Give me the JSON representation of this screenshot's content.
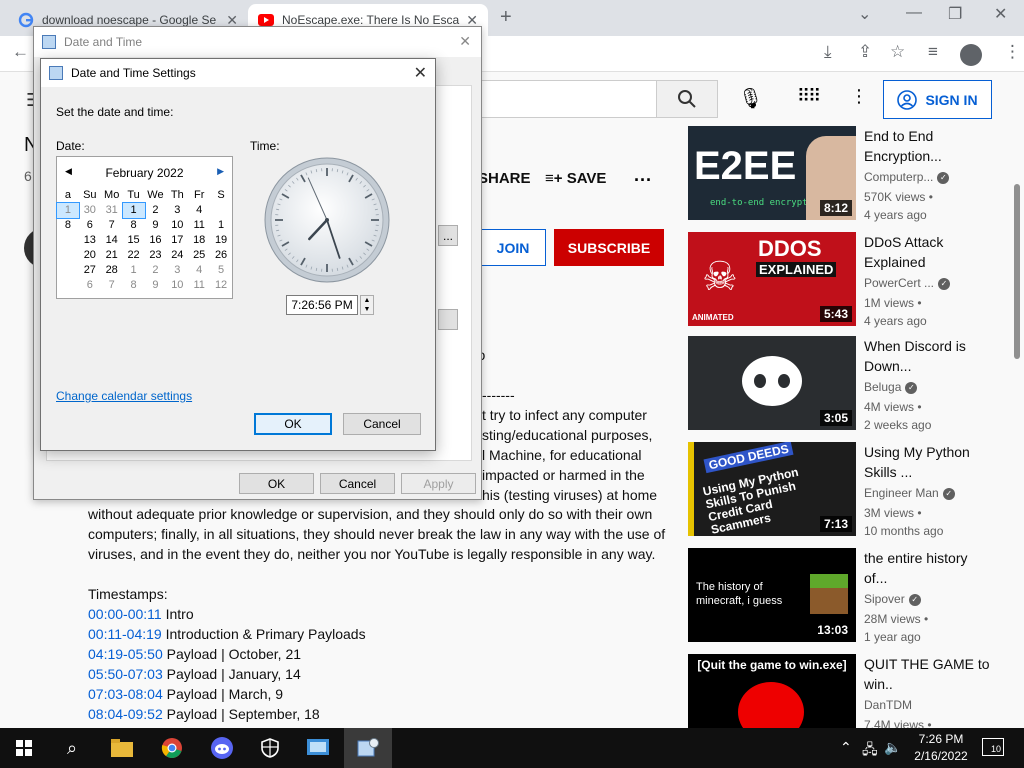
{
  "browser": {
    "tabs": [
      {
        "title": "download noescape - Google Se",
        "close": "✕"
      },
      {
        "title": "NoEscape.exe: There Is No Escap",
        "close": "✕"
      }
    ],
    "new_tab": "+",
    "win_controls": [
      "⌄",
      "—",
      "❐",
      "✕"
    ]
  },
  "youtube": {
    "sign_in": "SIGN IN",
    "title_partial": "N",
    "views_partial": "6",
    "share": "SHARE",
    "save": "SAVE",
    "join": "JOIN",
    "subscribe": "SUBSCRIBE",
    "desc_fragments": [
      "t too",
      "-------",
      "t try to infect any computer",
      "sting/educational purposes,",
      "l Machine, for educational",
      "impacted or harmed in the",
      "his (testing viruses) at home"
    ],
    "desc_paragraph": "without adequate prior knowledge or supervision, and they should only do so with their own computers; finally, in all situations, they should never break the law in any way with the use of viruses, and in the event they do, neither you nor YouTube is legally responsible in any way.",
    "timestamps_label": "Timestamps:",
    "timestamps": [
      {
        "time": "00:00-00:11",
        "label": "Intro"
      },
      {
        "time": "00:11-04:19",
        "label": "Introduction & Primary Payloads"
      },
      {
        "time": "04:19-05:50",
        "label": "Payload | October, 21"
      },
      {
        "time": "05:50-07:03",
        "label": "Payload | January, 14"
      },
      {
        "time": "07:03-08:04",
        "label": "Payload | March, 9"
      },
      {
        "time": "08:04-09:52",
        "label": "Payload | September, 18"
      }
    ],
    "recommended": [
      {
        "title": "End to End Encryption...",
        "channel": "Computerp...",
        "views": "570K views •",
        "age": "4 years ago",
        "duration": "8:12",
        "thumb_text": "E2EE",
        "thumb_sub": "end-to-end encryption"
      },
      {
        "title": "DDoS Attack Explained",
        "channel": "PowerCert ...",
        "views": "1M views •",
        "age": "4 years ago",
        "duration": "5:43",
        "thumb_text": "DDOS",
        "thumb_sub": "EXPLAINED",
        "thumb_tag": "ANIMATED"
      },
      {
        "title": "When Discord is Down...",
        "channel": "Beluga",
        "views": "4M views •",
        "age": "2 weeks ago",
        "duration": "3:05"
      },
      {
        "title": "Using My Python Skills ...",
        "channel": "Engineer Man",
        "views": "3M views •",
        "age": "10 months ago",
        "duration": "7:13",
        "thumb_text": "GOOD DEEDS",
        "thumb_sub": "Using My Python Skills To Punish Credit Card Scammers"
      },
      {
        "title": "the entire history of...",
        "channel": "Sipover",
        "views": "28M views •",
        "age": "1 year ago",
        "duration": "13:03",
        "thumb_text": "The history of minecraft, i guess"
      },
      {
        "title": "QUIT THE GAME to win..",
        "channel": "DanTDM",
        "views": "7.4M views •",
        "age": "",
        "duration": "",
        "thumb_text": "[Quit the game to win.exe]"
      }
    ]
  },
  "date_time_window": {
    "title": "Date and Time",
    "ok": "OK",
    "cancel": "Cancel",
    "apply": "Apply"
  },
  "settings_dialog": {
    "title": "Date and Time Settings",
    "instruction": "Set the date and time:",
    "date_label": "Date:",
    "time_label": "Time:",
    "month": "February 2022",
    "weekdays": [
      "a",
      "Su",
      "Mo",
      "Tu",
      "We",
      "Th",
      "Fr",
      "S"
    ],
    "weeks": [
      [
        "1",
        "30",
        "31",
        "1",
        "2",
        "3",
        "4",
        ""
      ],
      [
        "8",
        "6",
        "7",
        "8",
        "9",
        "10",
        "11",
        "1"
      ],
      [
        "",
        "13",
        "14",
        "15",
        "16",
        "17",
        "18",
        "19"
      ],
      [
        "",
        "20",
        "21",
        "22",
        "23",
        "24",
        "25",
        "26"
      ],
      [
        "",
        "27",
        "28",
        "1",
        "2",
        "3",
        "4",
        "5"
      ],
      [
        "",
        "6",
        "7",
        "8",
        "9",
        "10",
        "11",
        "12"
      ]
    ],
    "time_value": "7:26:56 PM",
    "clock": {
      "hour": 7,
      "minute": 26,
      "second": 56
    },
    "change_calendar": "Change calendar settings",
    "ok": "OK",
    "cancel": "Cancel"
  },
  "taskbar": {
    "time": "7:26 PM",
    "date": "2/16/2022",
    "notifications": "10"
  }
}
